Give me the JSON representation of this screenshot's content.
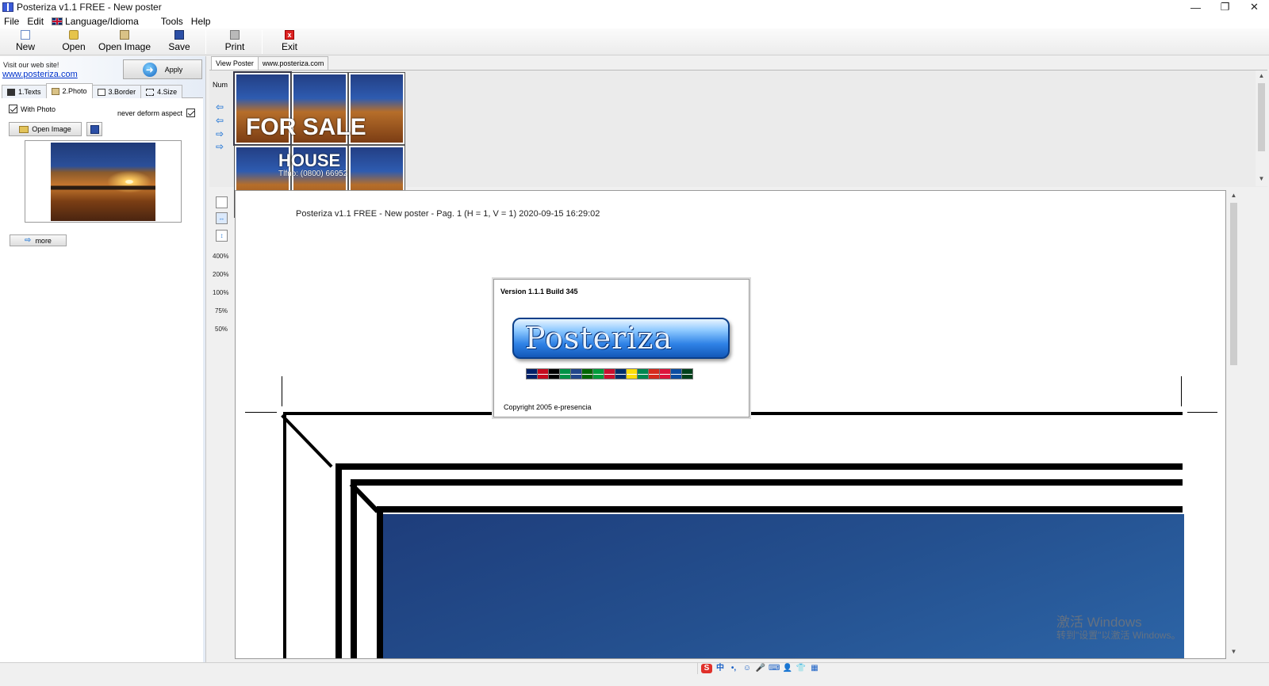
{
  "window": {
    "title": "Posteriza v1.1 FREE - New poster",
    "controls": [
      "—",
      "❐",
      "✕"
    ]
  },
  "menu": [
    "File",
    "Edit",
    "Language/Idioma",
    "Tools",
    "Help"
  ],
  "toolbar": {
    "new": "New",
    "open": "Open",
    "open_image": "Open Image",
    "save": "Save",
    "print": "Print",
    "exit": "Exit"
  },
  "left_panel": {
    "visit_label": "Visit our web site!",
    "site_link": "www.posteriza.com",
    "apply": "Apply",
    "tabs": [
      "1.Texts",
      "2.Photo",
      "3.Border",
      "4.Size"
    ],
    "active_tab": "2.Photo",
    "with_photo": "With Photo",
    "never_deform": "never deform aspect",
    "open_image": "Open Image",
    "more": "more"
  },
  "view_tabs": [
    "View Poster",
    "www.posteriza.com"
  ],
  "thumbs": {
    "num_label": "Num",
    "text1": "FOR SALE",
    "text2": "HOUSE",
    "text3": "Tlfno: (0800) 66952"
  },
  "zoom": {
    "levels": [
      "400%",
      "200%",
      "100%",
      "75%",
      "50%"
    ]
  },
  "canvas": {
    "page_header": "Posteriza v1.1 FREE - New poster - Pag. 1 (H = 1, V = 1) 2020-09-15  16:29:02"
  },
  "splash": {
    "version": "Version 1.1.1 Build 345",
    "logo_text": "Posteriza",
    "copyright": "Copyright 2005 e-presencia",
    "flag_colors": [
      "#012169",
      "#c60b1e",
      "#000000",
      "#009246",
      "#21468b",
      "#006600",
      "#009c3b",
      "#c8102e",
      "#002f6c",
      "#fcdd09",
      "#008751",
      "#d52b1e",
      "#dc143c",
      "#0b4ea2",
      "#01411c"
    ]
  },
  "watermark": {
    "line1": "激活 Windows",
    "line2": "转到\"设置\"以激活 Windows。"
  },
  "ime": [
    "S",
    "中",
    "•,",
    "☺",
    "🎤",
    "⌨",
    "👤",
    "👕",
    "▦"
  ]
}
